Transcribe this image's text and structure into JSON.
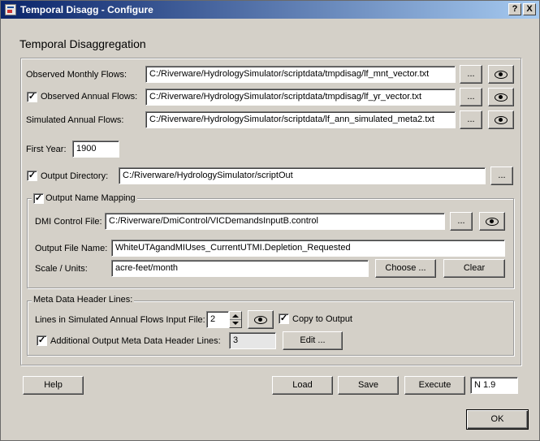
{
  "window": {
    "title": "Temporal Disagg - Configure",
    "help_glyph": "?",
    "close_glyph": "X"
  },
  "heading": "Temporal Disaggregation",
  "inputs": {
    "observed_monthly": {
      "label": "Observed Monthly Flows:",
      "value": "C:/Riverware/HydrologySimulator/scriptdata/tmpdisag/lf_mnt_vector.txt"
    },
    "observed_annual": {
      "label": "Observed Annual Flows:",
      "checked": true,
      "value": "C:/Riverware/HydrologySimulator/scriptdata/tmpdisag/lf_yr_vector.txt"
    },
    "simulated_annual": {
      "label": "Simulated Annual Flows:",
      "value": "C:/Riverware/HydrologySimulator/scriptdata/lf_ann_simulated_meta2.txt"
    },
    "first_year": {
      "label": "First Year:",
      "value": "1900"
    },
    "output_directory": {
      "label": "Output Directory:",
      "checked": true,
      "value": "C:/Riverware/HydrologySimulator/scriptOut"
    },
    "browse_label": "...",
    "view_icon": "eye-icon"
  },
  "output_name_mapping": {
    "title": "Output Name Mapping",
    "checked": true,
    "dmi_control_file": {
      "label": "DMI Control File:",
      "value": "C:/Riverware/DmiControl/VICDemandsInputB.control"
    },
    "output_file_name": {
      "label": "Output File Name:",
      "value": "WhiteUTAgandMIUses_CurrentUTMI.Depletion_Requested"
    },
    "scale_units": {
      "label": "Scale / Units:",
      "value": "acre-feet/month"
    },
    "choose_label": "Choose ...",
    "clear_label": "Clear"
  },
  "meta_data": {
    "title": "Meta Data Header Lines:",
    "lines_label": "Lines in Simulated Annual Flows Input File:",
    "lines_value": "2",
    "copy_to_output": {
      "label": "Copy to Output",
      "checked": true
    },
    "additional": {
      "label": "Additional Output Meta Data Header Lines:",
      "checked": true,
      "value": "3"
    },
    "edit_label": "Edit ..."
  },
  "footer": {
    "help_label": "Help",
    "load_label": "Load",
    "save_label": "Save",
    "execute_label": "Execute",
    "n_value": "N 1.9",
    "ok_label": "OK"
  }
}
